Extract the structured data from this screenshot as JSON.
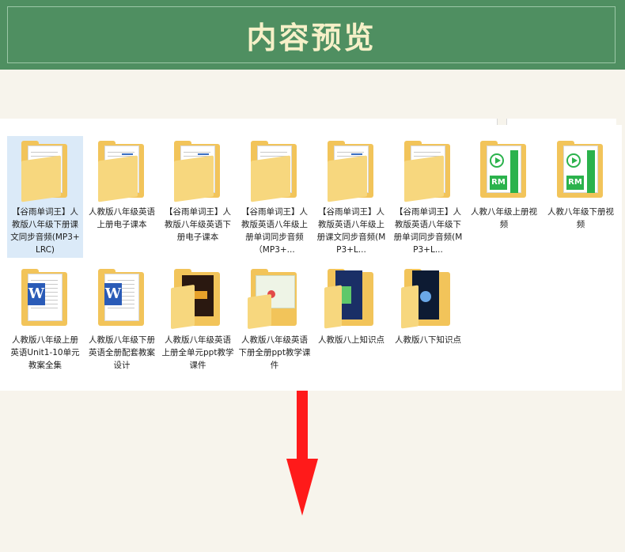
{
  "banner": {
    "title": "内容预览"
  },
  "explorer": {
    "items": [
      {
        "label": "【谷雨单词王】人教版八年级下册课文同步音频(MP3+LRC)",
        "icon": "folder-doc-icon"
      },
      {
        "label": "人教版八年级英语上册电子课本",
        "icon": "folder-doc-icon"
      },
      {
        "label": "【谷雨单词王】人教版八年级英语下册电子课本",
        "icon": "folder-doc-icon"
      },
      {
        "label": "【谷雨单词王】人教版英语八年级上册单词同步音频（MP3+...",
        "icon": "folder-doc-icon"
      },
      {
        "label": "【谷雨单词王】人教版英语八年级上册课文同步音频(MP3+L...",
        "icon": "folder-doc-icon"
      },
      {
        "label": "【谷雨单词王】人教版英语八年级下册单词同步音频(MP3+L...",
        "icon": "folder-doc-icon"
      },
      {
        "label": "人教八年级上册视频",
        "icon": "folder-video-icon",
        "badge": "RM"
      },
      {
        "label": "人教八年级下册视频",
        "icon": "folder-video-icon",
        "badge": "RM"
      },
      {
        "label": "人教版八年级上册英语Unit1-10单元教案全集",
        "icon": "folder-word-icon",
        "badge": "W"
      },
      {
        "label": "人教版八年级下册英语全册配套教案设计",
        "icon": "folder-word-icon",
        "badge": "W"
      },
      {
        "label": "人教版八年级英语上册全单元ppt教学课件",
        "icon": "folder-image-icon"
      },
      {
        "label": "人教版八年级英语下册全册ppt教学课件",
        "icon": "folder-image-icon"
      },
      {
        "label": "人教版八上知识点",
        "icon": "folder-image-icon"
      },
      {
        "label": "人教版八下知识点",
        "icon": "folder-image-icon"
      }
    ]
  },
  "colors": {
    "banner": "#4f8f61",
    "title": "#f6f0c8",
    "arrow": "#ff1a1a",
    "selected": "#dbeaf8"
  }
}
